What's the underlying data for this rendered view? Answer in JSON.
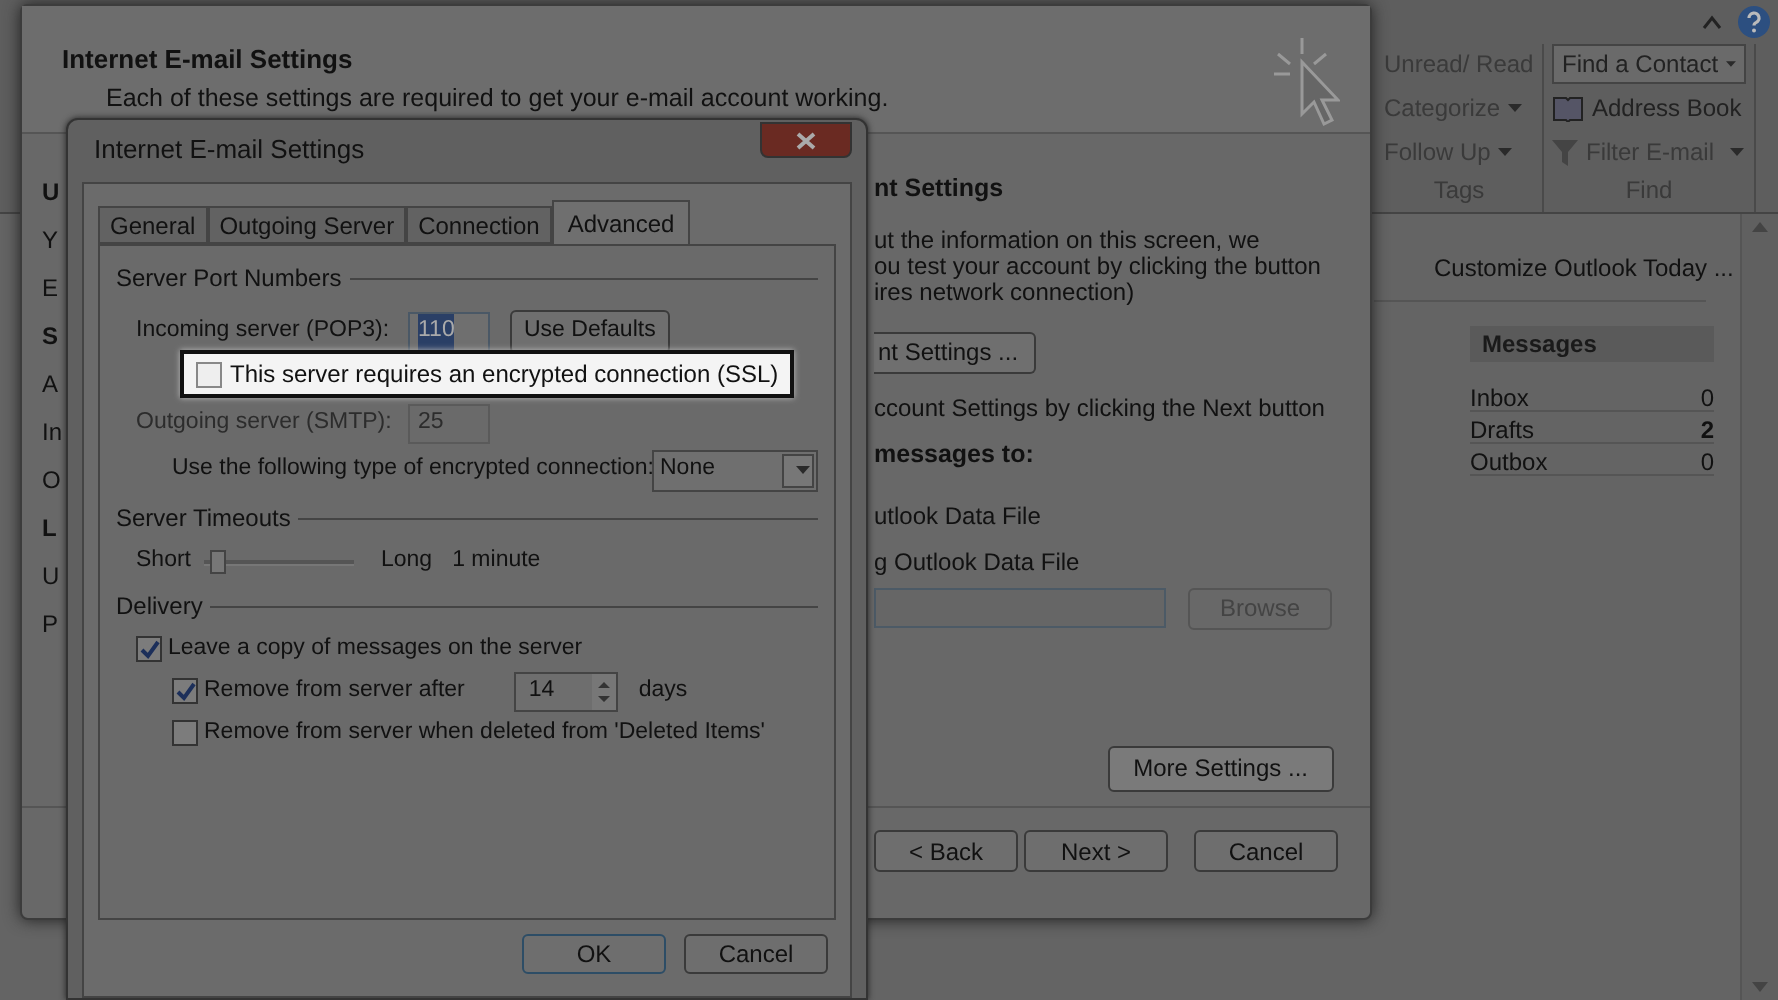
{
  "outlook": {
    "ribbon_groups": [
      {
        "label": "Tags",
        "items": [
          {
            "label": "Unread/ Read",
            "kind": "plain"
          },
          {
            "label": "Categorize",
            "kind": "menu"
          },
          {
            "label": "Follow Up",
            "kind": "menu"
          }
        ]
      },
      {
        "label": "Find",
        "items": [
          {
            "label": "Find a Contact",
            "kind": "field"
          },
          {
            "label": "Address Book",
            "kind": "book"
          },
          {
            "label": "Filter E-mail",
            "kind": "filter"
          }
        ]
      }
    ],
    "customize_link": "Customize Outlook Today ...",
    "messages": {
      "title": "Messages",
      "rows": [
        {
          "name": "Inbox",
          "count": "0",
          "bold": false
        },
        {
          "name": "Drafts",
          "count": "2",
          "bold": true
        },
        {
          "name": "Outbox",
          "count": "0",
          "bold": false
        }
      ]
    }
  },
  "wizard": {
    "title": "Internet E-mail Settings",
    "subtitle": "Each of these settings are required to get your e-mail account working.",
    "left_fragments": [
      {
        "text": "U",
        "bold": true
      },
      {
        "text": "Y",
        "bold": false
      },
      {
        "text": "E",
        "bold": false
      },
      {
        "text": "S",
        "bold": true
      },
      {
        "text": "A",
        "bold": false
      },
      {
        "text": "In",
        "bold": false
      },
      {
        "text": "O",
        "bold": false
      },
      {
        "text": "L",
        "bold": true
      },
      {
        "text": "U",
        "bold": false
      },
      {
        "text": "P",
        "bold": false
      }
    ],
    "heading": "nt Settings",
    "description_lines": [
      "ut the information on this screen, we",
      "ou test your account by clicking the button",
      "ires network connection)"
    ],
    "test_button": "nt Settings ...",
    "next_note": "ccount Settings by clicking the Next button",
    "deliver_heading": "messages to:",
    "options": [
      "utlook Data File",
      "g Outlook Data File"
    ],
    "browse_button": {
      "label": "Browse",
      "disabled": true
    },
    "more_settings": "More Settings ...",
    "footer_buttons": [
      "< Back",
      "Next >",
      "Cancel"
    ]
  },
  "dialog": {
    "title": "Internet E-mail Settings",
    "tabs": [
      {
        "label": "General",
        "selected": false
      },
      {
        "label": "Outgoing Server",
        "selected": false
      },
      {
        "label": "Connection",
        "selected": false
      },
      {
        "label": "Advanced",
        "selected": true
      }
    ],
    "port_group": "Server Port Numbers",
    "incoming": {
      "label": "Incoming server (POP3):",
      "value": "110",
      "text_selected": true
    },
    "use_defaults": "Use Defaults",
    "ssl": {
      "label": "This server requires an encrypted connection (SSL)",
      "checked": false
    },
    "outgoing": {
      "label": "Outgoing server (SMTP):",
      "value": "25",
      "disabled": true
    },
    "encryption": {
      "label": "Use the following type of encrypted connection:",
      "value": "None"
    },
    "timeouts_group": "Server Timeouts",
    "timeout": {
      "min_label": "Short",
      "max_label": "Long",
      "level": 0.05,
      "reading": "1 minute"
    },
    "delivery_group": "Delivery",
    "delivery": [
      {
        "label": "Leave a copy of messages on the server",
        "checked": true,
        "kind": "plain",
        "children": [
          {
            "label": "Remove from server after",
            "checked": true,
            "kind": "days",
            "value": "14",
            "unit": "days"
          },
          {
            "label": "Remove from server when deleted from 'Deleted Items'",
            "checked": false,
            "kind": "plain"
          }
        ]
      }
    ],
    "buttons": [
      "OK",
      "Cancel"
    ]
  }
}
